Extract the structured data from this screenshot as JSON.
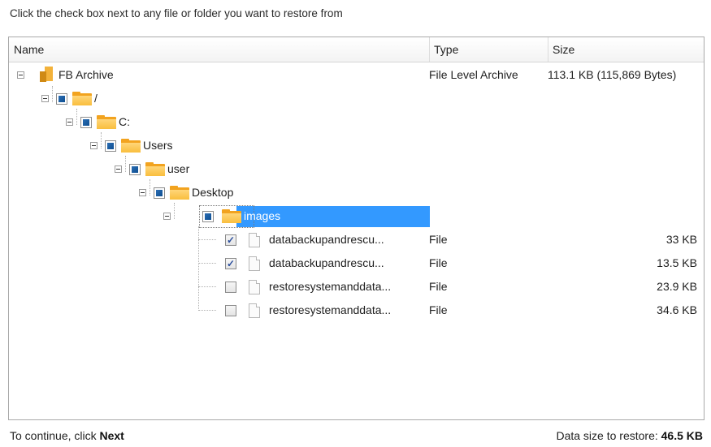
{
  "instruction": "Click the check box next to any file or folder you want to restore from",
  "columns": {
    "name": "Name",
    "type": "Type",
    "size": "Size"
  },
  "tree": {
    "root": {
      "label": "FB Archive",
      "type": "File Level Archive",
      "size": "113.1 KB (115,869 Bytes)"
    },
    "folders": [
      {
        "label": "/"
      },
      {
        "label": "C:"
      },
      {
        "label": "Users"
      },
      {
        "label": "user"
      },
      {
        "label": "Desktop"
      },
      {
        "label": "images",
        "selected": true
      }
    ],
    "files": [
      {
        "label": "databackupandrescu...",
        "type": "File",
        "size": "33 KB",
        "checked": true
      },
      {
        "label": "databackupandrescu...",
        "type": "File",
        "size": "13.5 KB",
        "checked": true
      },
      {
        "label": "restoresystemanddata...",
        "type": "File",
        "size": "23.9 KB",
        "checked": false
      },
      {
        "label": "restoresystemanddata...",
        "type": "File",
        "size": "34.6 KB",
        "checked": false
      }
    ]
  },
  "footer": {
    "continue_prefix": "To continue, click",
    "continue_action": "Next",
    "data_size_label": "Data size to restore:",
    "data_size_value": "46.5 KB"
  },
  "colors": {
    "selection": "#3399ff",
    "folder": "#f9be3e",
    "checkbox_partial": "#1a5ea3"
  }
}
